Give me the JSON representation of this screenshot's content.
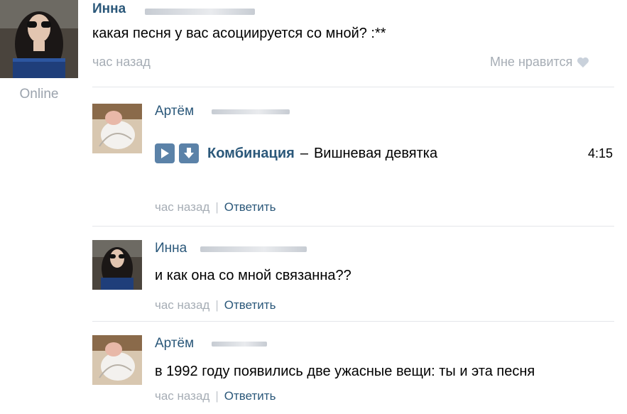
{
  "post": {
    "author": "Инна",
    "text": "какая песня у вас асоциируется со мной? :**",
    "time": "час назад",
    "like_label": "Мне нравится",
    "status": "Online"
  },
  "comments": [
    {
      "author": "Артём",
      "audio": {
        "artist": "Комбинация",
        "separator": "–",
        "title": "Вишневая девятка",
        "duration": "4:15"
      },
      "time": "час назад",
      "reply": "Ответить"
    },
    {
      "author": "Инна",
      "text": "и как она со мной связанна??",
      "time": "час назад",
      "reply": "Ответить"
    },
    {
      "author": "Артём",
      "text": "в 1992 году появились две ужасные вещи: ты и эта песня",
      "time": "час назад",
      "reply": "Ответить"
    }
  ],
  "meta_separator": "|",
  "icons": {
    "play": "play-icon",
    "download": "download-icon",
    "like": "heart-icon"
  },
  "colors": {
    "link": "#2b587a",
    "muted": "#a6adb5",
    "audio_button": "#5b82a8"
  }
}
